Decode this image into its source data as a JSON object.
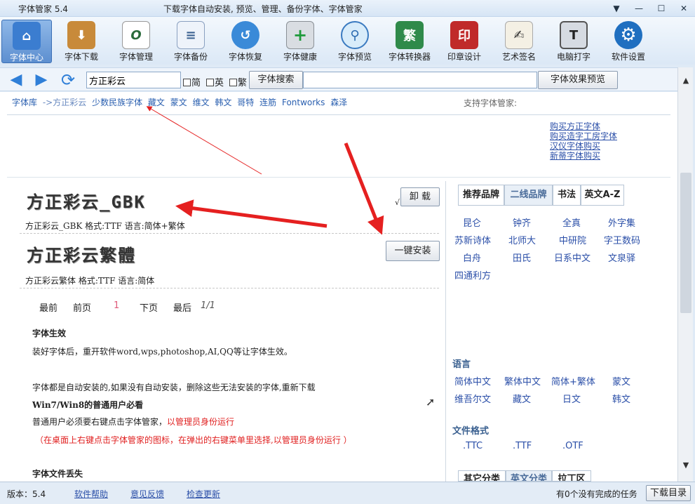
{
  "window": {
    "title": "字体管家 5.4",
    "subtitle": "下载字体自动安装, 预览、管理、备份字体、字体管家",
    "controls": [
      "▼",
      "—",
      "☐",
      "✕"
    ]
  },
  "toolbar": {
    "items": [
      {
        "label": "字体中心",
        "icon": "home-icon",
        "glyph": "⌂"
      },
      {
        "label": "字体下载",
        "icon": "download-icon",
        "glyph": "⬇"
      },
      {
        "label": "字体管理",
        "icon": "font-manage-icon",
        "glyph": "O"
      },
      {
        "label": "字体备份",
        "icon": "document-icon",
        "glyph": "≡"
      },
      {
        "label": "字体恢复",
        "icon": "restore-icon",
        "glyph": "↺"
      },
      {
        "label": "字体健康",
        "icon": "health-kit-icon",
        "glyph": "+"
      },
      {
        "label": "字体预览",
        "icon": "magnifier-icon",
        "glyph": "⚲"
      },
      {
        "label": "字体转换器",
        "icon": "converter-icon",
        "glyph": "繁"
      },
      {
        "label": "印章设计",
        "icon": "seal-icon",
        "glyph": "印"
      },
      {
        "label": "艺术签名",
        "icon": "signature-icon",
        "glyph": "✍"
      },
      {
        "label": "电脑打字",
        "icon": "computer-icon",
        "glyph": "T"
      },
      {
        "label": "软件设置",
        "icon": "gear-icon",
        "glyph": "⚙"
      }
    ]
  },
  "search": {
    "value": "方正彩云",
    "options": [
      "简",
      "英",
      "繁"
    ],
    "search_button": "字体搜索",
    "preview_button": "字体效果预览"
  },
  "breadcrumb": {
    "items": [
      "字体库",
      "->方正彩云",
      "少数民族字体",
      "藏文",
      "蒙文",
      "维文",
      "韩文",
      "哥特",
      "连筋",
      "Fontworks",
      "森泽"
    ]
  },
  "support_label": "支持字体管家:",
  "buy_links": [
    "购买方正字体",
    "购买造字工房字体",
    "汉仪字体购买",
    "新蒂字体购买"
  ],
  "fonts": [
    {
      "display": "方正彩云_GBK",
      "meta": "方正彩云_GBK 格式:TTF 语言:简体+繁体",
      "action": "卸 载",
      "check": "√"
    },
    {
      "display": "方正彩云繁體",
      "meta": "方正彩云繁体  格式:TTF 语言:简体",
      "action": "一键安装"
    }
  ],
  "pager": {
    "first": "最前",
    "prev": "前页",
    "current": "1",
    "next": "下页",
    "last": "最后",
    "total": "1/1"
  },
  "info": {
    "h1": "字体生效",
    "p1": "装好字体后，重开软件word,wps,photoshop,AI,QQ等让字体生效。",
    "p2": "字体都是自动安装的,如果没有自动安装，删除这些无法安装的字体,重新下载",
    "h2": "Win7/Win8的普通用户必看",
    "p3a": "普通用户必须要右键点击字体管家，",
    "p3b": "以管理员身份运行",
    "p4": "（在桌面上右键点击字体管家的图标，在弹出的右键菜单里选择,以管理员身份运行  ）",
    "h3": "字体文件丢失"
  },
  "right_panel": {
    "tabs": [
      "推荐品牌",
      "二线品牌",
      "书法",
      "英文A-Z"
    ],
    "brands": [
      "昆仑",
      "钟齐",
      "全真",
      "外字集",
      "苏新诗体",
      "北师大",
      "中研院",
      "字王数码",
      "白舟",
      "田氏",
      "日系中文",
      "文泉驿",
      "四通利方"
    ],
    "language_header": "语言",
    "languages": [
      "简体中文",
      "繁体中文",
      "简体+繁体",
      "蒙文",
      "维吾尔文",
      "藏文",
      "日文",
      "韩文"
    ],
    "format_header": "文件格式",
    "formats": [
      ".TTC",
      ".TTF",
      ".OTF"
    ],
    "bottom_tabs": [
      "其它分类",
      "英文分类",
      "拉丁区"
    ]
  },
  "status": {
    "version": "版本：5.4",
    "links": [
      "软件帮助",
      "意见反馈",
      "检查更新"
    ],
    "tasks": "有0个没有完成的任务",
    "download_button": "下载目录"
  },
  "colors": {
    "accent": "#2f7fd8",
    "link": "#2b4fa8",
    "annotation": "#e52020"
  }
}
